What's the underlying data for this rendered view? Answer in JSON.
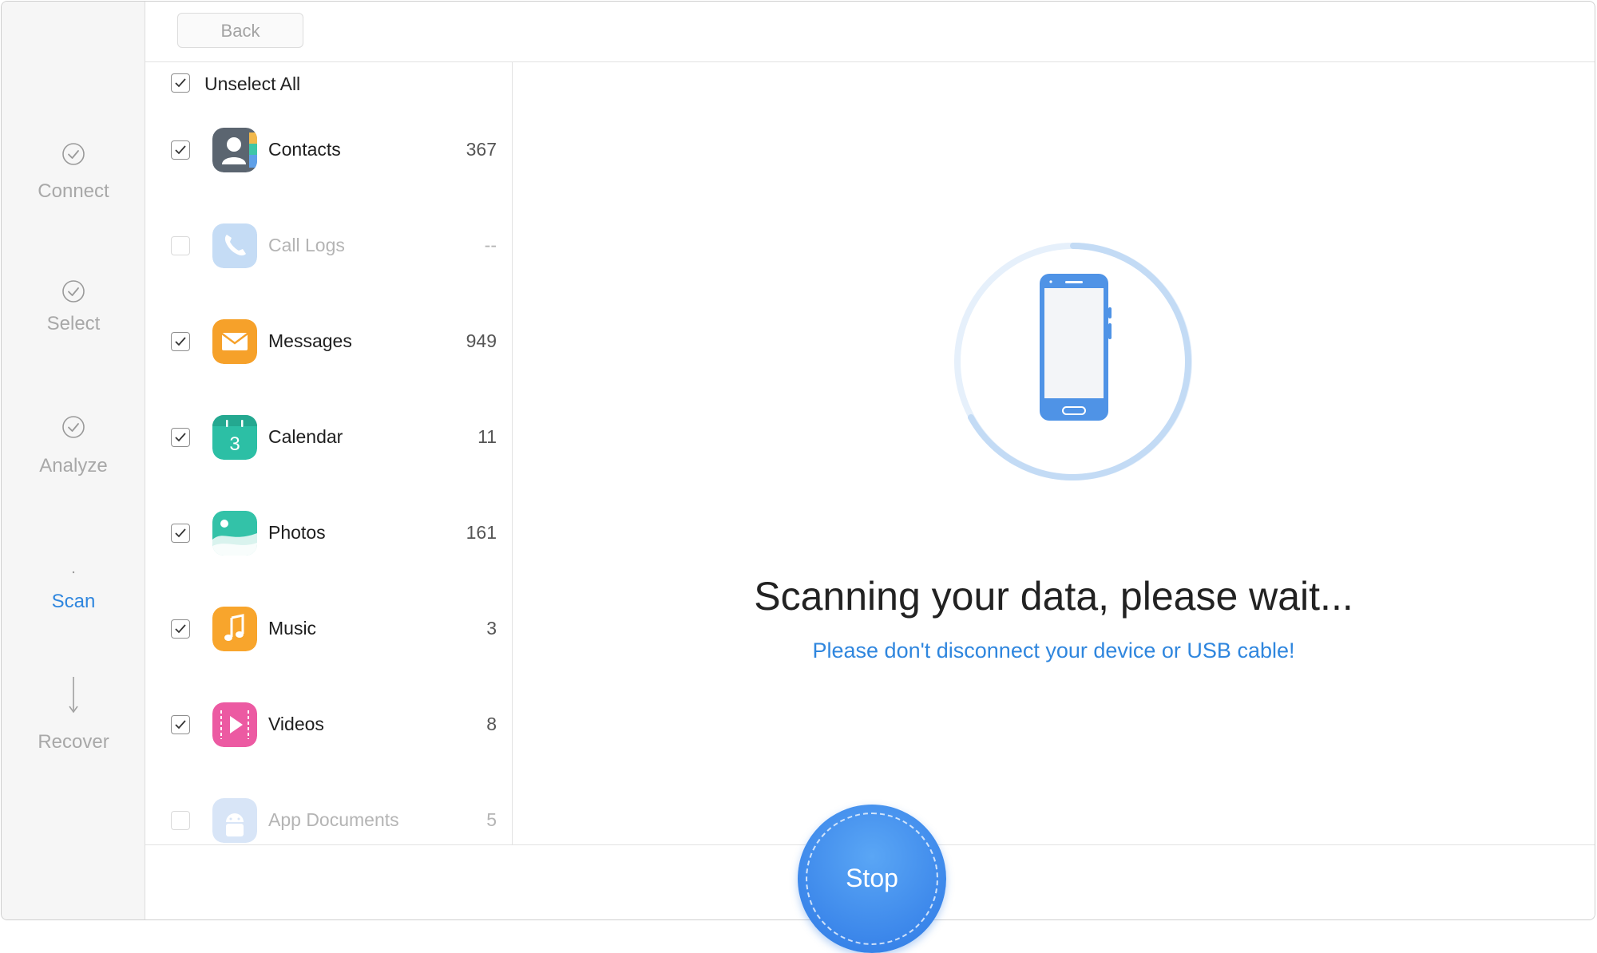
{
  "window": {
    "controls": [
      "close",
      "minimize"
    ]
  },
  "toolbar": {
    "back_label": "Back"
  },
  "steps": [
    {
      "label": "Connect",
      "icon": "check-circle-icon",
      "state": "done"
    },
    {
      "label": "Select",
      "icon": "check-circle-icon",
      "state": "done"
    },
    {
      "label": "Analyze",
      "icon": "check-circle-icon",
      "state": "done"
    },
    {
      "label": "Scan",
      "icon": "scan-dot-icon",
      "state": "active"
    },
    {
      "label": "Recover",
      "icon": "arrow-down-icon",
      "state": "pending"
    }
  ],
  "list": {
    "unselect_all_label": "Unselect All",
    "items": [
      {
        "name": "Contacts",
        "count": "367",
        "checked": true,
        "enabled": true,
        "icon": "contacts-icon"
      },
      {
        "name": "Call Logs",
        "count": "--",
        "checked": false,
        "enabled": false,
        "icon": "phone-icon"
      },
      {
        "name": "Messages",
        "count": "949",
        "checked": true,
        "enabled": true,
        "icon": "envelope-icon"
      },
      {
        "name": "Calendar",
        "count": "11",
        "checked": true,
        "enabled": true,
        "icon": "calendar-icon"
      },
      {
        "name": "Photos",
        "count": "161",
        "checked": true,
        "enabled": true,
        "icon": "photos-icon"
      },
      {
        "name": "Music",
        "count": "3",
        "checked": true,
        "enabled": true,
        "icon": "music-note-icon"
      },
      {
        "name": "Videos",
        "count": "8",
        "checked": true,
        "enabled": true,
        "icon": "video-play-icon"
      },
      {
        "name": "App Documents",
        "count": "5",
        "checked": false,
        "enabled": false,
        "icon": "android-icon"
      }
    ],
    "calendar_icon_digit": "3"
  },
  "main": {
    "headline": "Scanning your data, please wait...",
    "subline": "Please don't disconnect your device or USB cable!",
    "illustration": "phone-scan-icon"
  },
  "actions": {
    "stop_label": "Stop"
  },
  "colors": {
    "accent": "#2f86de",
    "stop_button": "#3b86ea",
    "contacts": "#5b6570",
    "call_logs": "#7fb2ea",
    "messages": "#f6a12a",
    "calendar": "#2cbfa5",
    "photos": "#33c2a8",
    "music": "#f8a52c",
    "videos": "#ec5aa2",
    "app_documents": "#a9c7ef"
  }
}
